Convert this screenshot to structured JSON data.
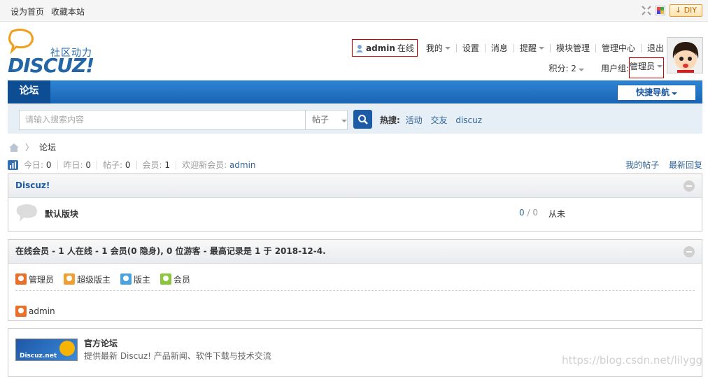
{
  "topbar": {
    "set_home": "设为首页",
    "bookmark": "收藏本站",
    "diy_label": "DIY",
    "diy_icon": "download-arrow-icon"
  },
  "logo": {
    "cn": "社区动力",
    "en": "DISCUZ!"
  },
  "user_menu": {
    "username": "admin",
    "online": "在线",
    "items": [
      "我的",
      "设置",
      "消息",
      "提醒",
      "模块管理",
      "管理中心",
      "退出"
    ],
    "points_label": "积分: 2",
    "group_label": "用户组: ",
    "group_value": "管理员"
  },
  "nav": {
    "tab_forum": "论坛",
    "quick_nav": "快捷导航"
  },
  "search": {
    "placeholder": "请输入搜索内容",
    "type": "帖子",
    "hot_label": "热搜:",
    "hot_items": [
      "活动",
      "交友",
      "discuz"
    ]
  },
  "breadcrumb": {
    "current": "论坛"
  },
  "stats": {
    "today_label": "今日:",
    "today": "0",
    "yesterday_label": "昨日:",
    "yesterday": "0",
    "posts_label": "帖子:",
    "posts": "0",
    "members_label": "会员:",
    "members": "1",
    "welcome_label": "欢迎新会员:",
    "newest_member": "admin",
    "my_posts": "我的帖子",
    "latest_replies": "最新回复"
  },
  "category": {
    "title": "Discuz!",
    "forum_name": "默认版块",
    "threads": "0",
    "posts": "/ 0",
    "last_post": "从未"
  },
  "online": {
    "title": "在线会员 - 1 人在线 - 1 会员(0 隐身), 0 位游客 - 最高记录是 1 于 2018-12-4.",
    "legend": [
      {
        "label": "管理员",
        "color": "#e8702a"
      },
      {
        "label": "超级版主",
        "color": "#f0a030"
      },
      {
        "label": "版主",
        "color": "#4aa3df"
      },
      {
        "label": "会员",
        "color": "#8cc63f"
      }
    ],
    "users": [
      "admin"
    ]
  },
  "friend_link": {
    "logo_text": "Discuz.net",
    "name": "官方论坛",
    "desc": "提供最新 Discuz! 产品新闻、软件下载与技术交流"
  },
  "watermark": "https://blog.csdn.net/lilygg"
}
